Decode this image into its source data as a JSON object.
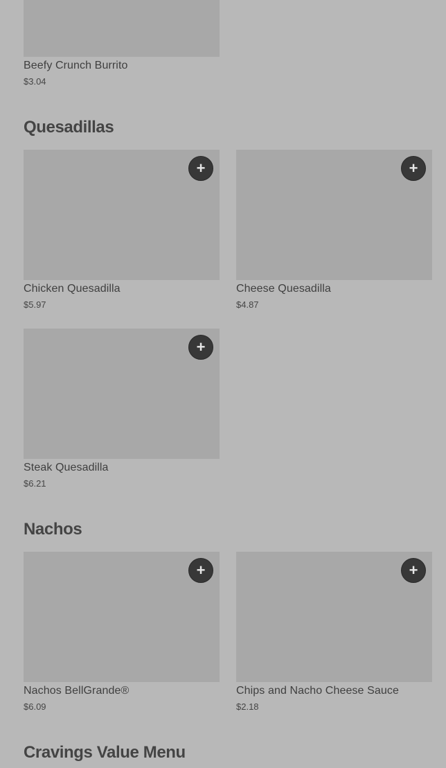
{
  "top_item": {
    "name": "Beefy Crunch Burrito",
    "price": "$3.04"
  },
  "sections": [
    {
      "title": "Quesadillas",
      "items": [
        {
          "name": "Chicken Quesadilla",
          "price": "$5.97",
          "add": "+"
        },
        {
          "name": "Cheese Quesadilla",
          "price": "$4.87",
          "add": "+"
        },
        {
          "name": "Steak Quesadilla",
          "price": "$6.21",
          "add": "+"
        }
      ]
    },
    {
      "title": "Nachos",
      "items": [
        {
          "name": "Nachos BellGrande®",
          "price": "$6.09",
          "add": "+"
        },
        {
          "name": "Chips and Nacho Cheese Sauce",
          "price": "$2.18",
          "add": "+"
        }
      ]
    },
    {
      "title": "Cravings Value Menu"
    }
  ],
  "icons": {
    "add": "plus-icon"
  }
}
